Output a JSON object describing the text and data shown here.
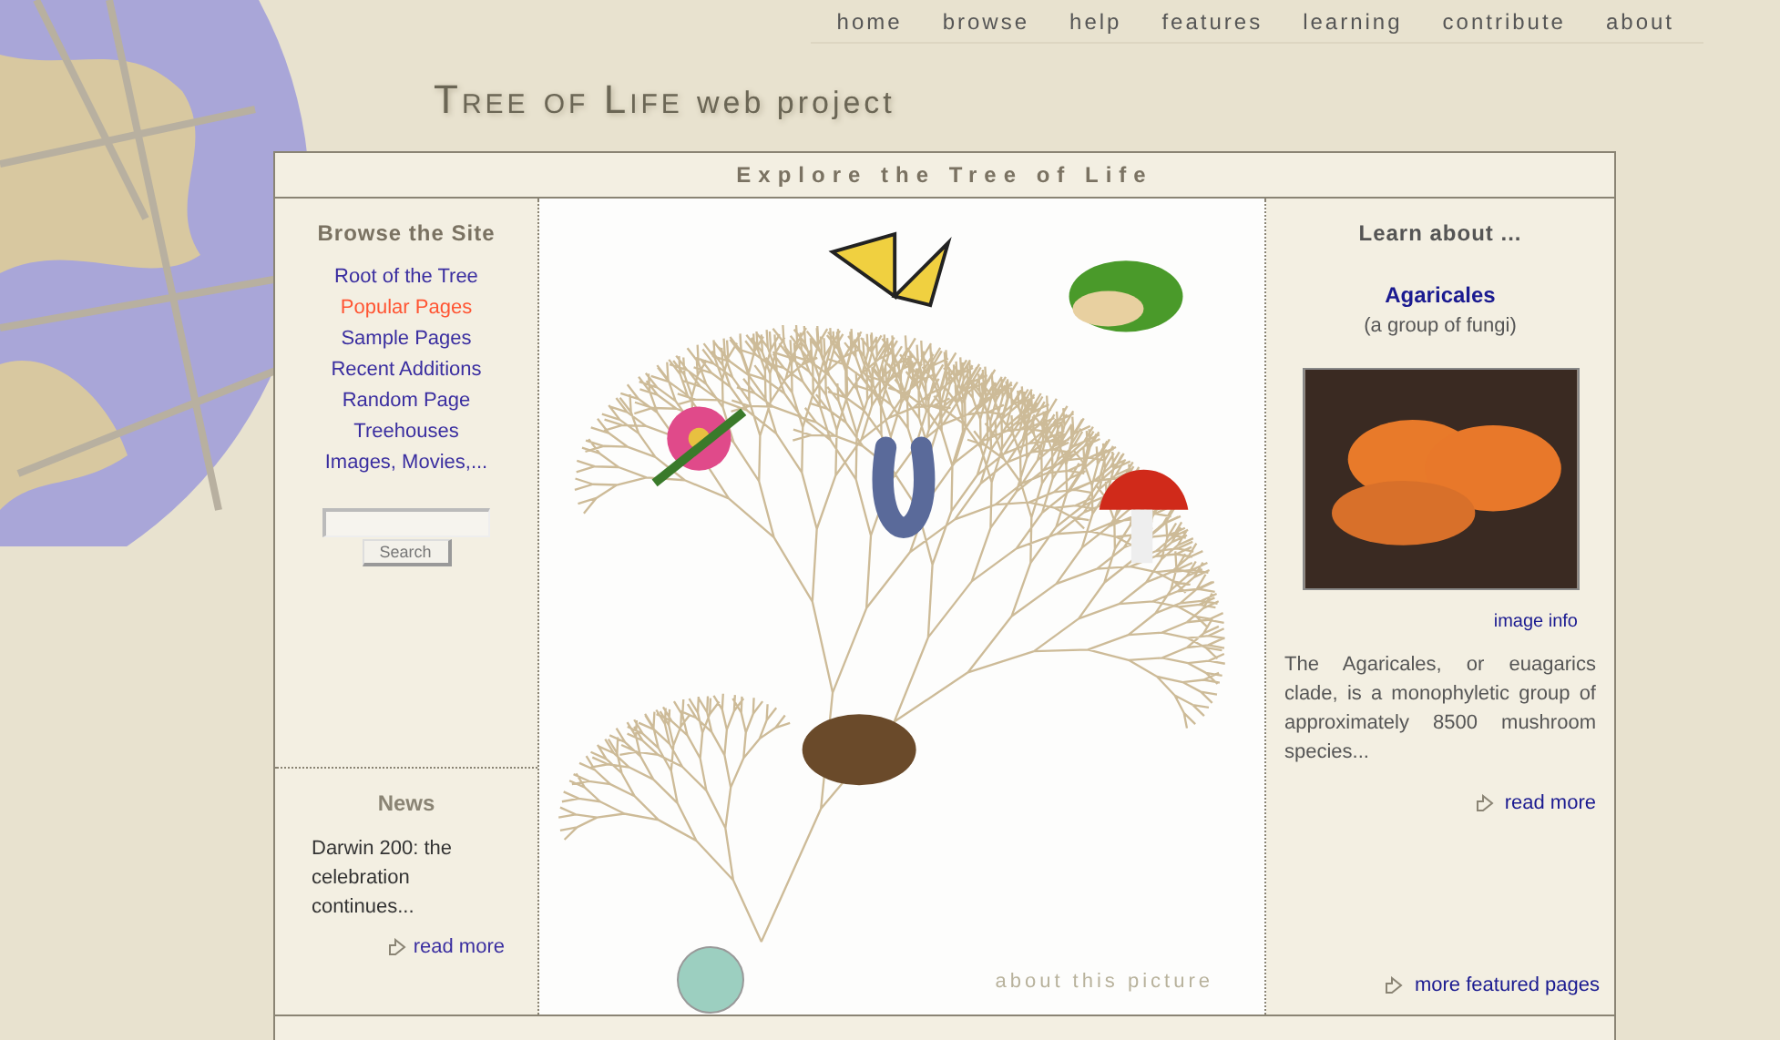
{
  "nav": [
    {
      "label": "home"
    },
    {
      "label": "browse"
    },
    {
      "label": "help"
    },
    {
      "label": "features"
    },
    {
      "label": "learning"
    },
    {
      "label": "contribute"
    },
    {
      "label": "about"
    }
  ],
  "site_title": {
    "name": "Tree of Life",
    "suffix": "web project"
  },
  "main_heading": "Explore the Tree of Life",
  "browse": {
    "heading": "Browse the Site",
    "links": [
      {
        "label": "Root of the Tree",
        "active": false
      },
      {
        "label": "Popular Pages",
        "active": true
      },
      {
        "label": "Sample Pages",
        "active": false
      },
      {
        "label": "Recent Additions",
        "active": false
      },
      {
        "label": "Random Page",
        "active": false
      },
      {
        "label": "Treehouses",
        "active": false
      },
      {
        "label": "Images, Movies,...",
        "active": false
      }
    ],
    "search_button": "Search"
  },
  "news": {
    "heading": "News",
    "text": "Darwin 200: the celebration continues...",
    "link": "read more"
  },
  "picture": {
    "caption": "about this picture"
  },
  "learn": {
    "heading": "Learn about ...",
    "name": "Agaricales",
    "subtitle": "(a group of fungi)",
    "image_info": "image info",
    "description": "The Agaricales, or euagarics clade, is a monophyletic group of approximately 8500 mushroom species...",
    "link": "read more",
    "more": "more featured pages"
  }
}
